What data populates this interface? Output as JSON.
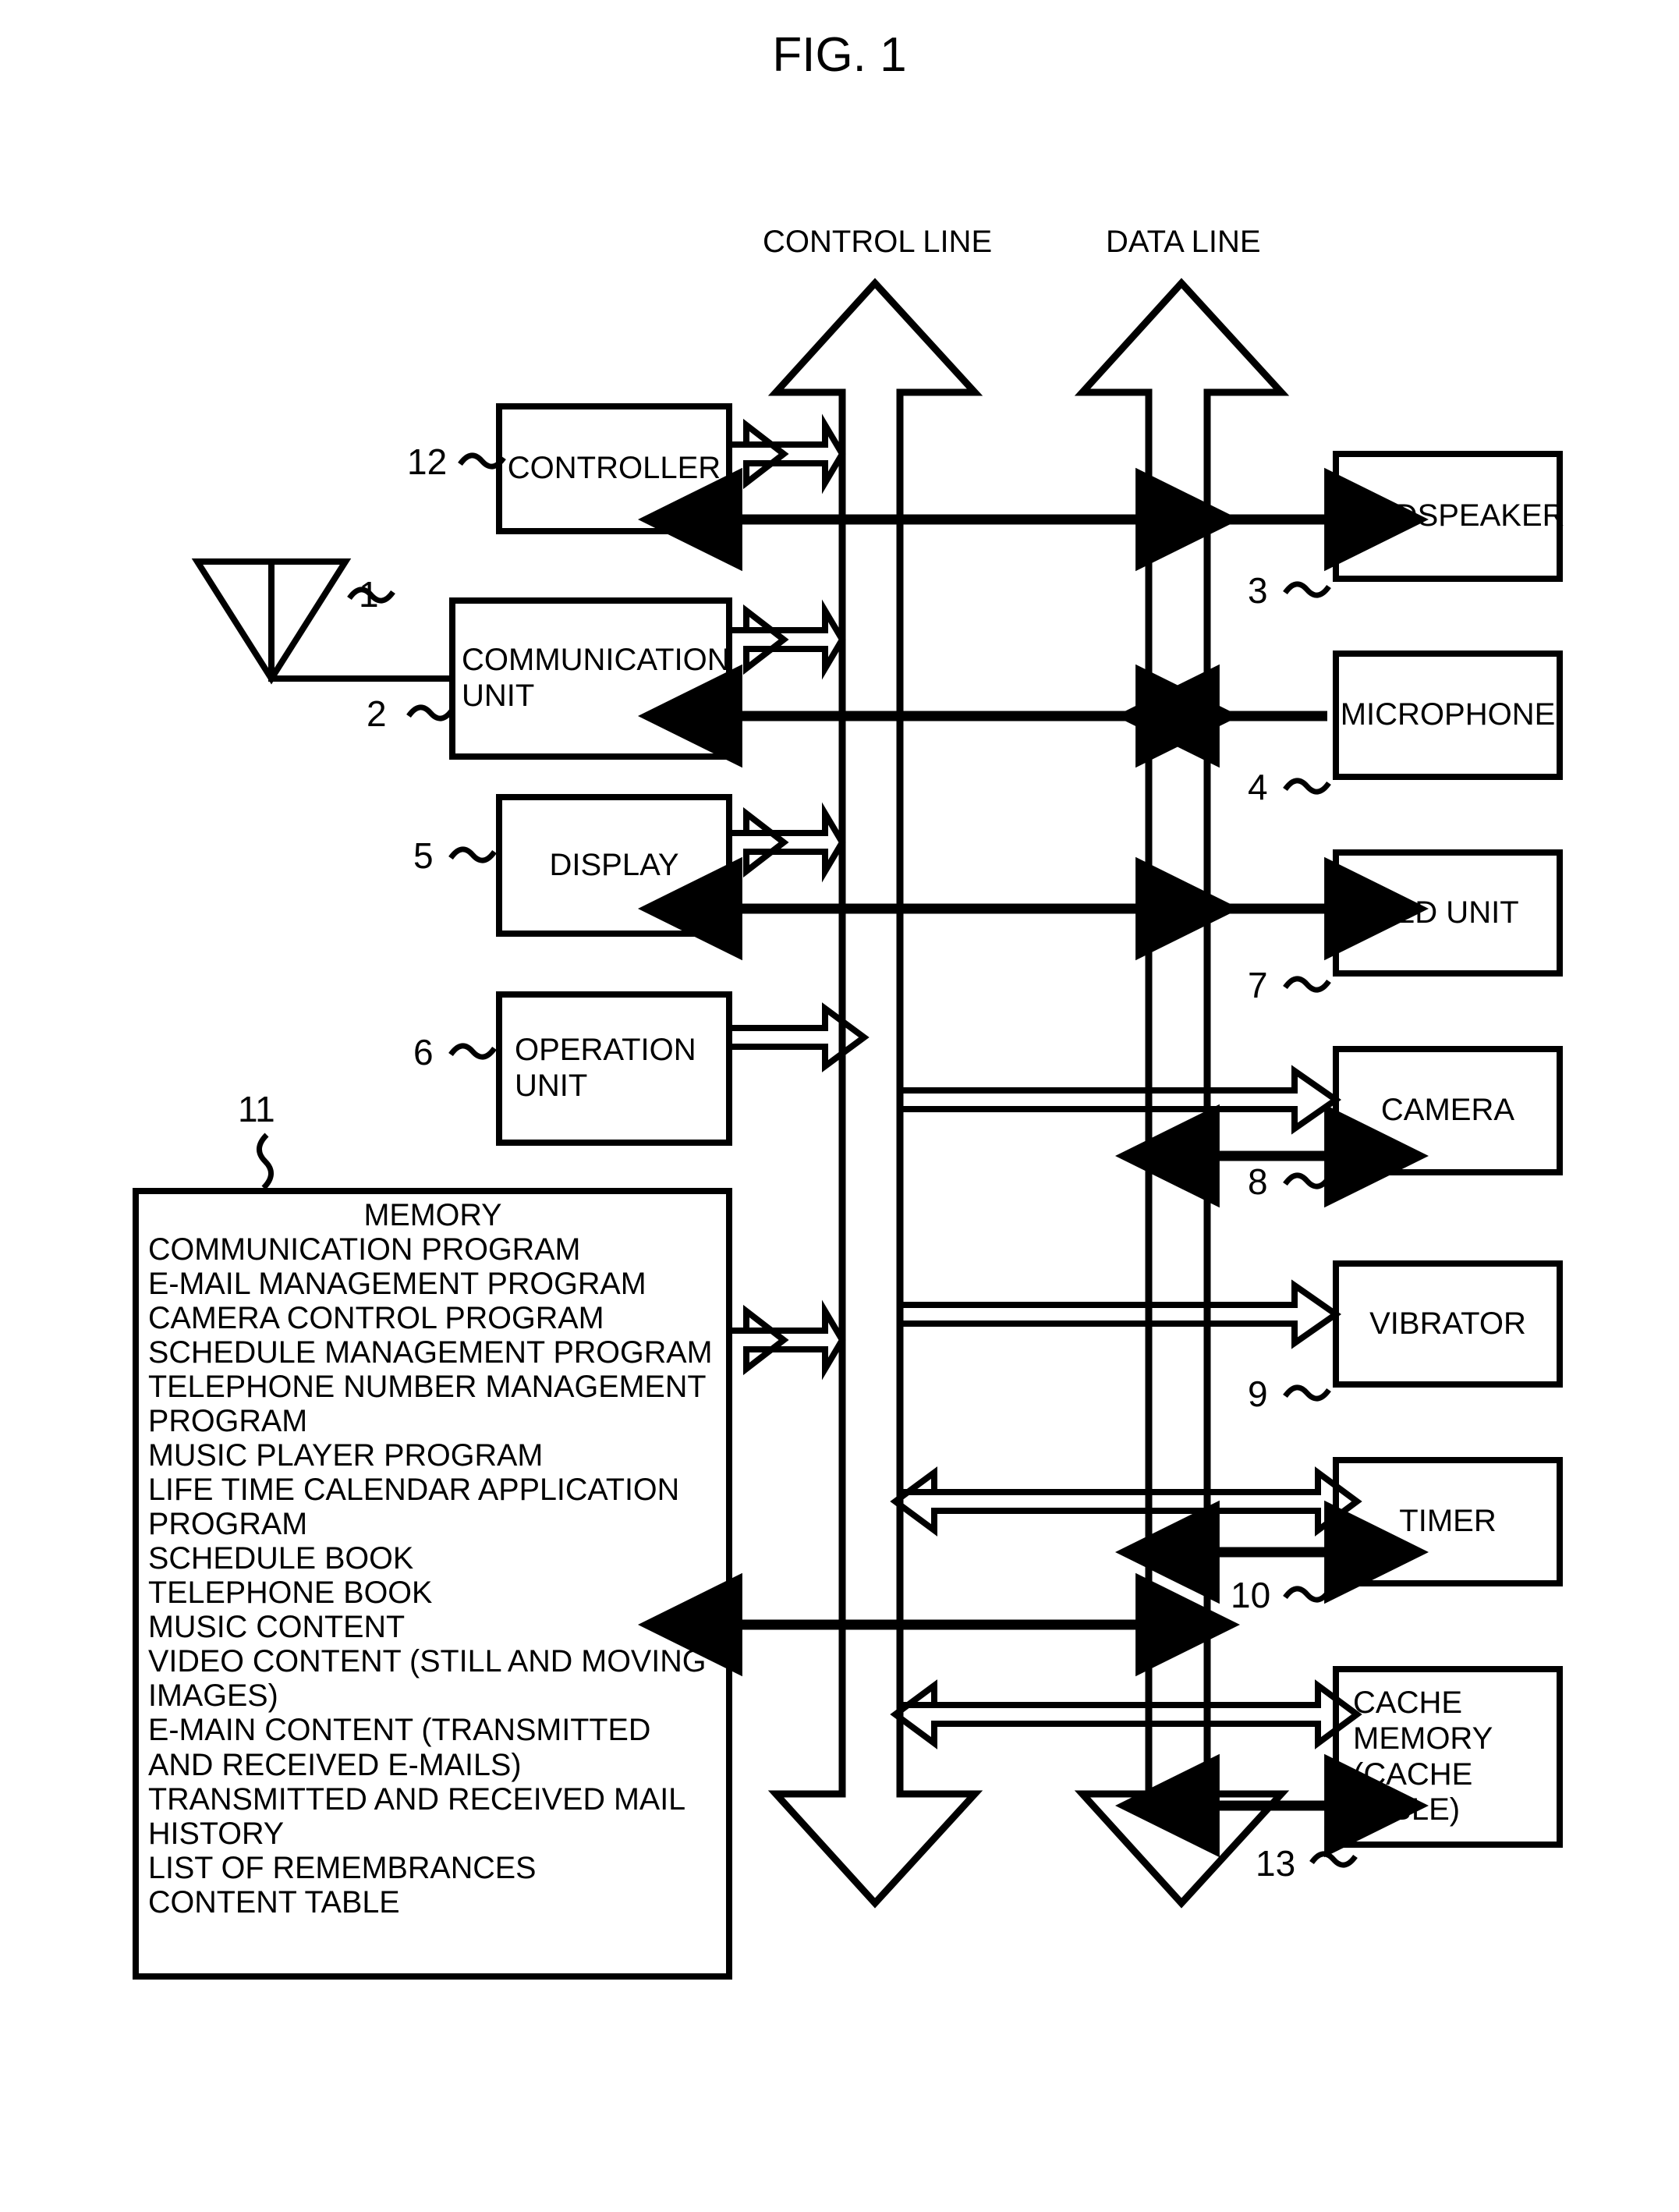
{
  "figure": {
    "title": "FIG. 1",
    "bus_labels": {
      "control": "CONTROL LINE",
      "data": "DATA LINE"
    },
    "line_color": "#000000",
    "background": "#ffffff"
  },
  "left_blocks": [
    {
      "label": "CONTROLLER",
      "ref": "12",
      "align": "center"
    },
    {
      "label": "COMMUNICATION\nUNIT",
      "ref": "2",
      "align": "left"
    },
    {
      "label": "DISPLAY",
      "ref": "5",
      "align": "center"
    },
    {
      "label": "OPERATION\nUNIT",
      "ref": "6",
      "align": "left"
    }
  ],
  "antenna": {
    "ref": "1"
  },
  "memory": {
    "ref": "11",
    "title": "MEMORY",
    "items": [
      "COMMUNICATION PROGRAM",
      "E-MAIL MANAGEMENT PROGRAM",
      "CAMERA CONTROL PROGRAM",
      "SCHEDULE MANAGEMENT PROGRAM",
      "TELEPHONE NUMBER MANAGEMENT PROGRAM",
      "MUSIC PLAYER PROGRAM",
      "LIFE TIME CALENDAR APPLICATION PROGRAM",
      "SCHEDULE BOOK",
      "TELEPHONE BOOK",
      "MUSIC CONTENT",
      "VIDEO CONTENT (STILL AND MOVING IMAGES)",
      "E-MAIN CONTENT (TRANSMITTED AND RECEIVED E-MAILS)",
      "TRANSMITTED AND RECEIVED MAIL HISTORY",
      "LIST OF REMEMBRANCES",
      "CONTENT TABLE"
    ]
  },
  "right_blocks": [
    {
      "label": "LOUDSPEAKER",
      "ref": "3"
    },
    {
      "label": "MICROPHONE",
      "ref": "4"
    },
    {
      "label": "LED UNIT",
      "ref": "7"
    },
    {
      "label": "CAMERA",
      "ref": "8"
    },
    {
      "label": "VIBRATOR",
      "ref": "9"
    },
    {
      "label": "TIMER",
      "ref": "10"
    },
    {
      "label": "CACHE\nMEMORY\n(CACHE\nTABLE)",
      "ref": "13"
    }
  ]
}
